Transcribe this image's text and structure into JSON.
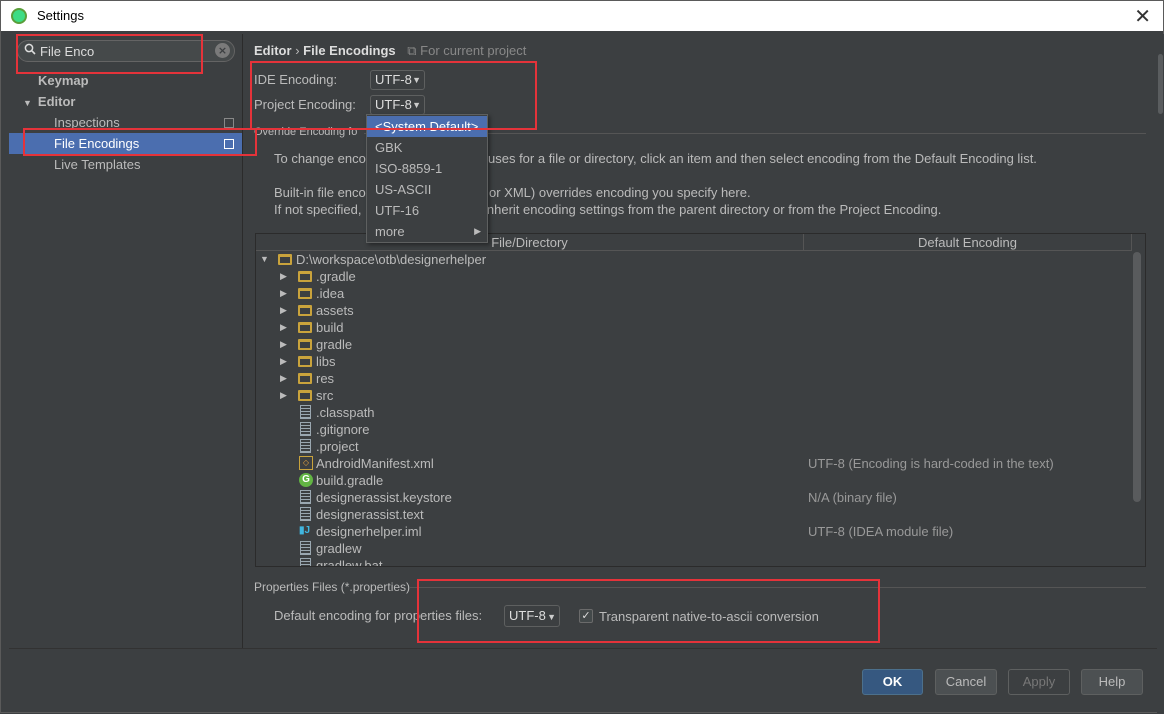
{
  "window": {
    "title": "Settings",
    "close": "✕"
  },
  "sidebar": {
    "search_value": "File Enco",
    "items": [
      {
        "label": "Keymap"
      },
      {
        "label": "Editor",
        "toggle": "▼"
      },
      {
        "label": "Inspections"
      },
      {
        "label": "File Encodings"
      },
      {
        "label": "Live Templates"
      }
    ]
  },
  "main": {
    "crumb_parent": "Editor",
    "crumb_sep": "›",
    "crumb_current": "File Encodings",
    "crumb_scope": "For current project",
    "ide_encoding_label": "IDE Encoding:",
    "ide_encoding_value": "UTF-8",
    "project_encoding_label": "Project Encoding:",
    "project_encoding_value": "UTF-8",
    "override_label": "Override Encoding fo",
    "desc_line1_a": "To change enco",
    "desc_line1_b": "uses for a file or directory, click an item and then select encoding from the Default Encoding list.",
    "desc_line2_a": "Built-in file enco",
    "desc_line2_b": "or XML) overrides encoding you specify here.",
    "desc_line3_a": "If not specified,",
    "desc_line3_b": "inherit encoding settings from the parent directory or from the Project Encoding.",
    "table": {
      "col_file": "File/Directory",
      "col_enc": "Default Encoding",
      "rows": [
        {
          "name": "D:\\workspace\\otb\\designerhelper",
          "enc": ""
        },
        {
          "name": ".gradle",
          "enc": ""
        },
        {
          "name": ".idea",
          "enc": ""
        },
        {
          "name": "assets",
          "enc": ""
        },
        {
          "name": "build",
          "enc": ""
        },
        {
          "name": "gradle",
          "enc": ""
        },
        {
          "name": "libs",
          "enc": ""
        },
        {
          "name": "res",
          "enc": ""
        },
        {
          "name": "src",
          "enc": ""
        },
        {
          "name": ".classpath",
          "enc": ""
        },
        {
          "name": ".gitignore",
          "enc": ""
        },
        {
          "name": ".project",
          "enc": ""
        },
        {
          "name": "AndroidManifest.xml",
          "enc": "UTF-8 (Encoding is hard-coded in the text)"
        },
        {
          "name": "build.gradle",
          "enc": ""
        },
        {
          "name": "designerassist.keystore",
          "enc": "N/A (binary file)"
        },
        {
          "name": "designerassist.text",
          "enc": ""
        },
        {
          "name": "designerhelper.iml",
          "enc": "UTF-8 (IDEA module file)"
        },
        {
          "name": "gradlew",
          "enc": ""
        },
        {
          "name": "gradlew.bat",
          "enc": ""
        }
      ]
    },
    "dropdown": {
      "options": [
        "<System Default>",
        "GBK",
        "ISO-8859-1",
        "US-ASCII",
        "UTF-16",
        "more"
      ],
      "more_arrow": "▶"
    },
    "properties_section": "Properties Files (*.properties)",
    "properties_label": "Default encoding for properties files:",
    "properties_value": "UTF-8",
    "native_ascii_label": "Transparent native-to-ascii conversion",
    "native_ascii_checked": "✓"
  },
  "footer": {
    "ok": "OK",
    "cancel": "Cancel",
    "apply": "Apply",
    "help": "Help"
  },
  "colors": {
    "accent": "#4b6eaf",
    "highlight_box": "#e5333a",
    "folder": "#c9a33c"
  },
  "icons": {
    "search": "⚲",
    "clear": "×",
    "arrow_down": "▼",
    "arrow_right": "▶"
  }
}
